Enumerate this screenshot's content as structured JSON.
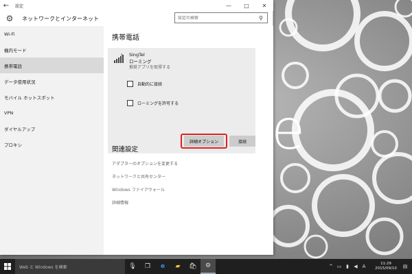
{
  "window": {
    "title": "設定",
    "back_glyph": "←",
    "minimize_glyph": "—",
    "maximize_glyph": "□",
    "close_glyph": "✕"
  },
  "header": {
    "category_title": "ネットワークとインターネット",
    "search_placeholder": "設定の検索"
  },
  "sidebar": {
    "items": [
      {
        "label": "Wi-Fi"
      },
      {
        "label": "機内モード"
      },
      {
        "label": "携帯電話",
        "selected": true
      },
      {
        "label": "データ使用状況"
      },
      {
        "label": "モバイル ホットスポット"
      },
      {
        "label": "VPN"
      },
      {
        "label": "ダイヤルアップ"
      },
      {
        "label": "プロキシ"
      }
    ]
  },
  "content": {
    "title": "携帯電話",
    "network": {
      "name": "SingTel",
      "status": "ローミング",
      "sub": "推奨アプリを取得する",
      "auto_connect_label": "自動的に接続",
      "roaming_label": "ローミングを許可する",
      "advanced_button": "詳細オプション",
      "connect_button": "接続"
    },
    "related": {
      "title": "関連設定",
      "links": [
        "アダプターのオプションを変更する",
        "ネットワークと共有センター",
        "Windows ファイアウォール",
        "詳細情報"
      ]
    }
  },
  "desktop": {
    "wallpaper_letter": "e"
  },
  "taskbar": {
    "search_placeholder": "Web と Windows を検索",
    "time": "11:29",
    "date": "2015/09/10",
    "tray_chevron": "^"
  },
  "colors": {
    "highlight_outline": "#e0201b",
    "selected_nav": "#d9d9d9",
    "taskbar": "#1f1f1f"
  }
}
